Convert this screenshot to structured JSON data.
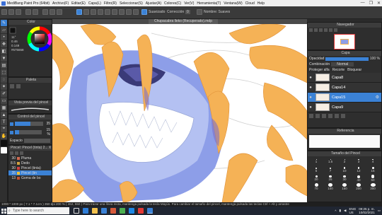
{
  "window": {
    "title": "MediBang Paint Pro (64bit)",
    "menu": [
      "Archivo(F)",
      "Editar(E)",
      "Capa(L)",
      "Filtro(R)",
      "Seleccionar(S)",
      "Ajustar(A)",
      "Colores(C)",
      "Ver(V)",
      "Herramienta(T)",
      "Ventana(W)",
      "Cloud",
      "Help"
    ],
    "controls": [
      "—",
      "❐",
      "✕"
    ]
  },
  "toolbar": {
    "suavizado_label": "Suavizado",
    "correccion_label": "Corrección",
    "correccion_value": "0",
    "brush_name": "Nombre: Suaves"
  },
  "canvas": {
    "tab_title": "Chupacabra lleko (Recuperado).mdp"
  },
  "color_panel": {
    "title": "Color",
    "h": "11°",
    "s": "0.46",
    "v": "0.149",
    "hex": "#575658"
  },
  "palette_panel": {
    "title": "Paleta"
  },
  "brush_preview_panel": {
    "title": "Vista previa del pincel"
  },
  "brush_control_panel": {
    "title": "Control del pincel",
    "size": "35",
    "opacity": "15 %",
    "spacing_label": "Espacio"
  },
  "brush_list_panel": {
    "title": "Pincel: Pincel (tinta) 2... X",
    "items": [
      {
        "size": "30",
        "name": "Pluma",
        "color": "#d06a50"
      },
      {
        "size": "8.5",
        "name": "Dedo",
        "color": "#d0a040"
      },
      {
        "size": "30",
        "name": "Pincel (tinta)",
        "color": "#d04040"
      },
      {
        "size": "35",
        "name": "Pincel (tin",
        "color": "#f0c030"
      },
      {
        "size": "13",
        "name": "Goma de bo",
        "color": "#c05030"
      }
    ]
  },
  "navigator_panel": {
    "title": "Navegador"
  },
  "layer_panel": {
    "title": "Capa",
    "opacity_label": "Opacidad",
    "opacity_value": "100 %",
    "blend_label": "Combinación",
    "blend_value": "Normal",
    "protect_label": "Proteger alfa",
    "clip_label": "Recorte",
    "lock_label": "Bloquear",
    "layers": [
      "Capa8",
      "Capa14",
      "Capa15",
      "Capa9"
    ]
  },
  "reference_panel": {
    "title": "Referencia"
  },
  "brush_size_panel": {
    "title": "Tamaño del Pincel",
    "sizes": [
      "1",
      "1.5",
      "2",
      "3",
      "4",
      "5",
      "7",
      "10",
      "12",
      "15",
      "20",
      "25",
      "30",
      "40",
      "50",
      "70",
      "100",
      "150",
      "200",
      "300"
    ]
  },
  "status": {
    "text": "1000 * 1000 px  ( 7.1 * 7.1cm )  350 dpi  200 %  ( 462, 550 )  Para trazar una línea recta, mantenga pulsada la tecla Mayús. Para cambiar el tamaño del pincel, mantenga pulsada las teclas Ctrl + Alt y arrastre"
  },
  "taskbar": {
    "search_placeholder": "Type here to search",
    "lang": "ENG",
    "region": "US",
    "time": "09:25 p. m.",
    "date": "10/02/2021"
  },
  "colors": {
    "accent": "#3b82d6",
    "fur_orange": "#f5b256",
    "body_blue": "#7c8fe3",
    "panel": "#2e2e2e"
  }
}
